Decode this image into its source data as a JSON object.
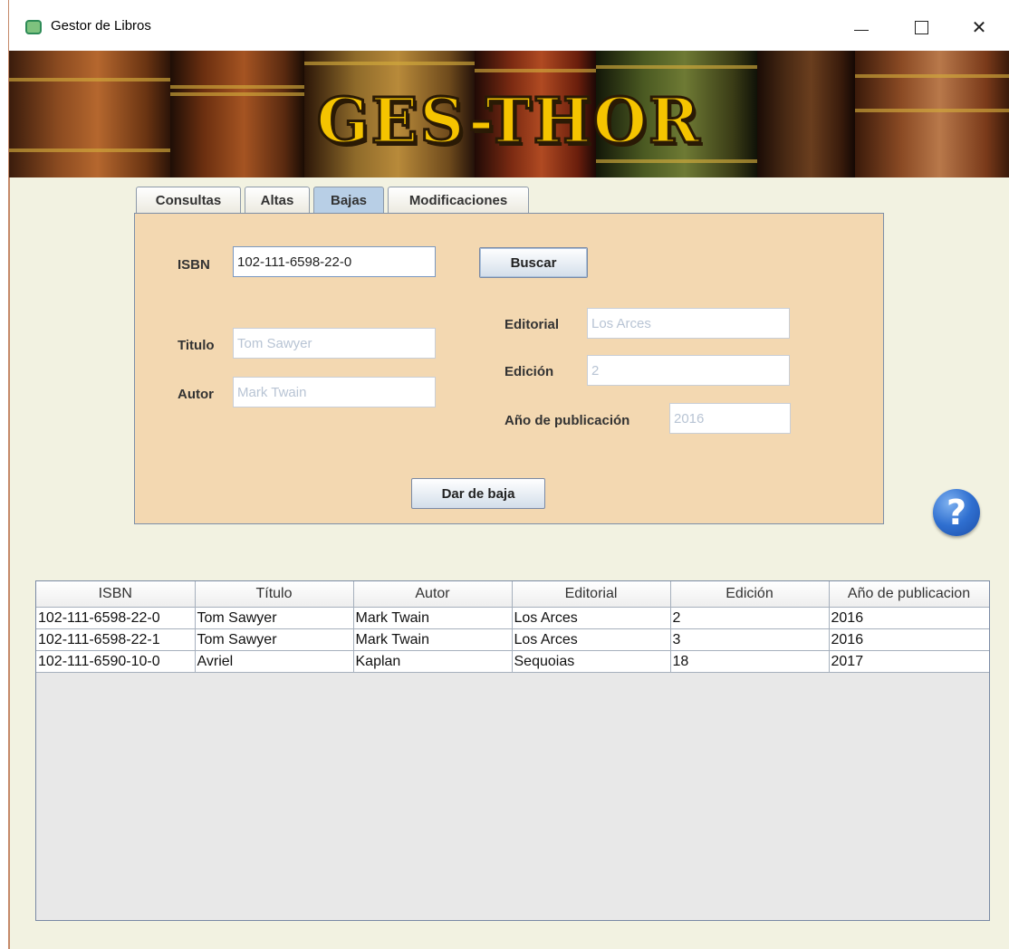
{
  "window": {
    "title": "Gestor de Libros",
    "minimize": "",
    "maximize": "",
    "close": "✕"
  },
  "banner": {
    "title": "GES-THOR"
  },
  "tabs": [
    {
      "label": "Consultas"
    },
    {
      "label": "Altas"
    },
    {
      "label": "Bajas",
      "active": true
    },
    {
      "label": "Modificaciones"
    }
  ],
  "form": {
    "isbn_label": "ISBN",
    "isbn_value": "102-111-6598-22-0",
    "buscar_label": "Buscar",
    "titulo_label": "Titulo",
    "titulo_value": "Tom Sawyer",
    "autor_label": "Autor",
    "autor_value": "Mark Twain",
    "editorial_label": "Editorial",
    "editorial_value": "Los Arces",
    "edicion_label": "Edición",
    "edicion_value": "2",
    "anio_label": "Año de publicación",
    "anio_value": "2016",
    "dar_de_baja_label": "Dar de baja"
  },
  "help": {
    "symbol": "?"
  },
  "table": {
    "headers": [
      "ISBN",
      "Título",
      "Autor",
      "Editorial",
      "Edición",
      "Año de publicacion"
    ],
    "rows": [
      [
        "102-111-6598-22-0",
        "Tom Sawyer",
        "Mark Twain",
        "Los Arces",
        "2",
        "2016"
      ],
      [
        "102-111-6598-22-1",
        "Tom Sawyer",
        "Mark Twain",
        "Los Arces",
        "3",
        "2016"
      ],
      [
        "102-111-6590-10-0",
        "Avriel",
        "Kaplan",
        "Sequoias",
        "18",
        "2017"
      ]
    ]
  },
  "colors": {
    "panel_bg": "#f3d8b1",
    "window_bg": "#f2f2e1",
    "active_tab": "#b8cfe6",
    "banner_title": "#f5c400",
    "help_blue": "#2f6fd0"
  }
}
